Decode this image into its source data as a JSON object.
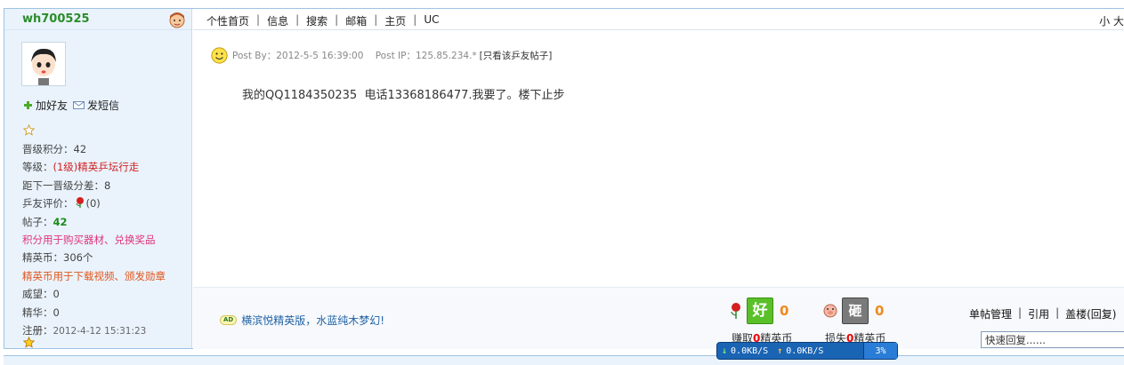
{
  "user": {
    "name": "wh700525",
    "add_friend": "加好友",
    "send_msg": "发短信"
  },
  "profile": {
    "upgrade_points_label": "晋级积分：",
    "upgrade_points": "42",
    "level_label": "等级：",
    "level": "(1级)精英乒坛行走",
    "next_level_label": "距下一晋级分差：",
    "next_level": "8",
    "rating_label": "乒友评价：",
    "rating": "(0)",
    "posts_label": "帖子：",
    "posts": "42",
    "points_note": "积分用于购买器材、兑换奖品",
    "coins_label": "精英币：",
    "coins": "306个",
    "coins_note": "精英币用于下载视频、颁发勋章",
    "prestige_label": "威望：",
    "prestige": "0",
    "essence_label": "精华：",
    "essence": "0",
    "register_label": "注册：",
    "register": "2012-4-12 15:31:23"
  },
  "nav": {
    "items": [
      "个性首页",
      "信息",
      "搜索",
      "邮箱",
      "主页",
      "UC"
    ],
    "right": "小 大"
  },
  "post": {
    "meta_prefix": "Post By：2012-5-5 16:39:00    Post IP：125.85.234.*",
    "only_this": "[只看该乒友帖子]",
    "content": "我的QQ1184350235  电话13368186477.我要了。楼下止步"
  },
  "footer": {
    "ad_badge": "AD",
    "ad_text": "横滨悦精英版，水蓝纯木梦幻!",
    "good_label": "好",
    "good_count": "0",
    "bad_label": "砸",
    "bad_count": "0",
    "earn_prefix": "赚取",
    "earn_num": "0",
    "earn_suffix": "精英币",
    "lose_prefix": "损失",
    "lose_num": "0",
    "lose_suffix": "精英币",
    "actions": [
      "单帖管理",
      "引用",
      "盖楼(回复)"
    ],
    "quick_reply_value": "快速回复......"
  },
  "netbar": {
    "down": "0.0KB/S",
    "up": "0.0KB/S",
    "percent": "3%"
  },
  "colors": {
    "border": "#9fc3e2",
    "sidebar_bg": "#eaf3fc",
    "username": "#2a8d2a",
    "count_orange": "#f08a1c"
  }
}
